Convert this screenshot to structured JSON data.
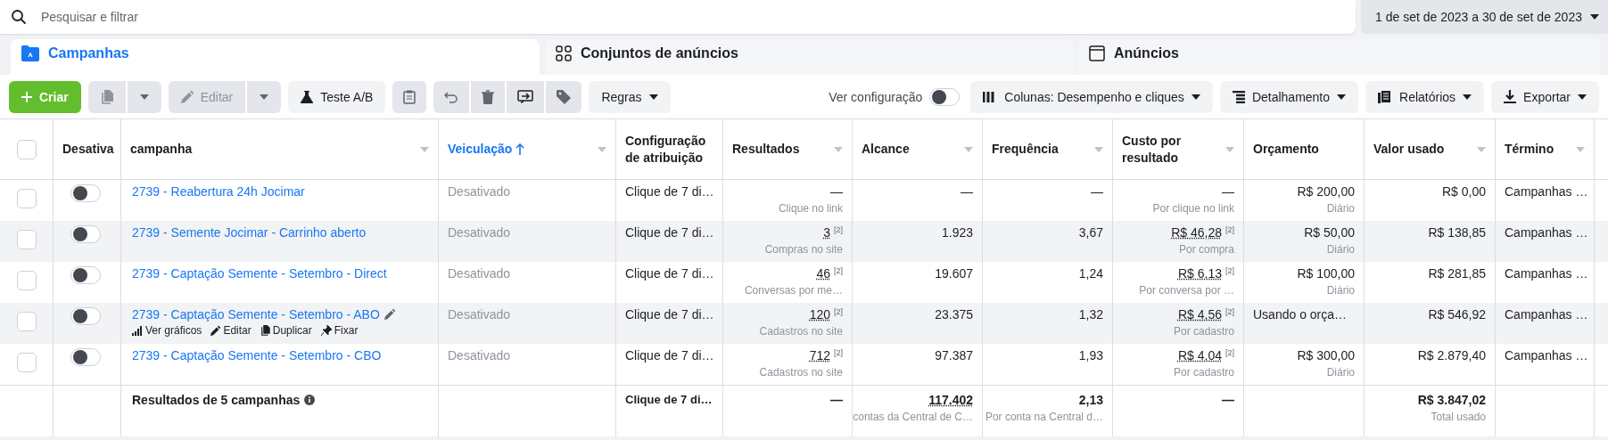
{
  "search": {
    "placeholder": "Pesquisar e filtrar"
  },
  "date_range": {
    "label": "1 de set de 2023 a 30 de set de 2023"
  },
  "tabs": [
    {
      "label": "Campanhas",
      "selected": true,
      "kind": "campaigns"
    },
    {
      "label": "Conjuntos de anúncios",
      "selected": false,
      "kind": "adsets"
    },
    {
      "label": "Anúncios",
      "selected": false,
      "kind": "ads"
    }
  ],
  "toolbar": {
    "create": "Criar",
    "duplicate": {
      "disabled": true
    },
    "edit": {
      "label": "Editar",
      "disabled": true
    },
    "ab_test": "Teste A/B",
    "rules": "Regras",
    "view_setup": {
      "label": "Ver configuração",
      "on": false
    },
    "columns": "Colunas: Desempenho e cliques",
    "breakdown": "Detalhamento",
    "reports": "Relatórios",
    "export": "Exportar"
  },
  "table": {
    "select_all": {
      "checked": false
    },
    "columns": [
      {
        "label": "Desativa",
        "menu": false,
        "sorted": false
      },
      {
        "label": "campanha",
        "menu": true,
        "sorted": false
      },
      {
        "label": "Veiculação",
        "menu": true,
        "sorted": true
      },
      {
        "label": "Configuração de atribuição",
        "menu": false,
        "sorted": false
      },
      {
        "label": "Resultados",
        "menu": true,
        "sorted": false
      },
      {
        "label": "Alcance",
        "menu": true,
        "sorted": false
      },
      {
        "label": "Frequência",
        "menu": true,
        "sorted": false
      },
      {
        "label": "Custo por resultado",
        "menu": true,
        "sorted": false
      },
      {
        "label": "Orçamento",
        "menu": false,
        "sorted": false
      },
      {
        "label": "Valor usado",
        "menu": true,
        "sorted": false
      },
      {
        "label": "Término",
        "menu": true,
        "sorted": false
      }
    ],
    "rows": [
      {
        "checked": false,
        "on": false,
        "name": "2739 - Reabertura 24h Jocimar",
        "delivery": "Desativado",
        "attribution": "Clique de 7 di…",
        "results": {
          "value": "—",
          "sub": "Clique no link"
        },
        "reach": "—",
        "frequency": "—",
        "cost": {
          "value": "—",
          "sub": "Por clique no link"
        },
        "budget": {
          "value": "R$ 200,00",
          "sub": "Diário"
        },
        "spent": "R$ 0,00",
        "end": "Campanhas …"
      },
      {
        "checked": false,
        "on": false,
        "name": "2739 - Semente Jocimar - Carrinho aberto",
        "delivery": "Desativado",
        "attribution": "Clique de 7 di…",
        "results": {
          "value": "3",
          "note": "[2]",
          "sub": "Compras no site"
        },
        "reach": "1.923",
        "frequency": "3,67",
        "cost": {
          "value": "R$ 46,28",
          "note": "[2]",
          "sub": "Por compra"
        },
        "budget": {
          "value": "R$ 50,00",
          "sub": "Diário"
        },
        "spent": "R$ 138,85",
        "end": "Campanhas …"
      },
      {
        "checked": false,
        "on": false,
        "name": "2739 - Captação Semente - Setembro - Direct",
        "delivery": "Desativado",
        "attribution": "Clique de 7 di…",
        "results": {
          "value": "46",
          "note": "[2]",
          "sub": "Conversas por me…"
        },
        "reach": "19.607",
        "frequency": "1,24",
        "cost": {
          "value": "R$ 6,13",
          "note": "[2]",
          "sub": "Por conversa por …"
        },
        "budget": {
          "value": "R$ 100,00",
          "sub": "Diário"
        },
        "spent": "R$ 281,85",
        "end": "Campanhas …"
      },
      {
        "checked": false,
        "on": false,
        "name": "2739 - Captação Semente - Setembro - ABO",
        "actions": [
          {
            "label": "Ver gráficos",
            "kind": "charts"
          },
          {
            "label": "Editar",
            "kind": "edit"
          },
          {
            "label": "Duplicar",
            "kind": "duplicate"
          },
          {
            "label": "Fixar",
            "kind": "pin"
          }
        ],
        "delivery": "Desativado",
        "attribution": "Clique de 7 di…",
        "results": {
          "value": "120",
          "note": "[2]",
          "sub": "Cadastros no site"
        },
        "reach": "23.375",
        "frequency": "1,32",
        "cost": {
          "value": "R$ 4,56",
          "note": "[2]",
          "sub": "Por cadastro"
        },
        "budget": {
          "value": "Usando o orça…"
        },
        "spent": "R$ 546,92",
        "end": "Campanhas …"
      },
      {
        "checked": false,
        "on": false,
        "name": "2739 - Captação Semente - Setembro - CBO",
        "delivery": "Desativado",
        "attribution": "Clique de 7 di…",
        "results": {
          "value": "712",
          "note": "[2]",
          "sub": "Cadastros no site"
        },
        "reach": "97.387",
        "frequency": "1,93",
        "cost": {
          "value": "R$ 4,04",
          "note": "[2]",
          "sub": "Por cadastro"
        },
        "budget": {
          "value": "R$ 300,00",
          "sub": "Diário"
        },
        "spent": "R$ 2.879,40",
        "end": "Campanhas …"
      }
    ],
    "total": {
      "label": "Resultados de 5 campanhas",
      "attribution": "Clique de 7 di…",
      "results": "—",
      "reach": {
        "value": "117.402",
        "sub": "contas da Central de C…"
      },
      "frequency": {
        "value": "2,13",
        "sub": "Por conta na Central d…"
      },
      "cost": "—",
      "spent": {
        "value": "R$ 3.847,02",
        "sub": "Total usado"
      }
    }
  }
}
